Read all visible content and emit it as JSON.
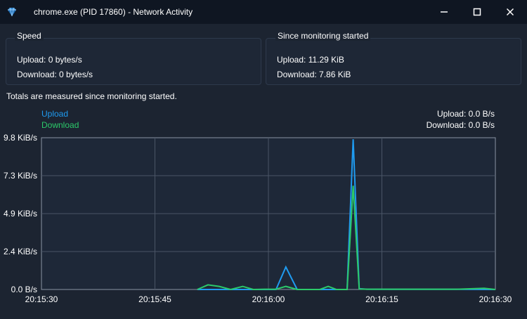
{
  "window": {
    "title": "chrome.exe (PID 17860) - Network Activity",
    "icon": "diamond-app-icon",
    "controls": [
      "minimize-icon",
      "maximize-icon",
      "close-icon"
    ]
  },
  "speed_panel": {
    "title": "Speed",
    "upload": "Upload: 0 bytes/s",
    "download": "Download: 0 bytes/s"
  },
  "totals_panel": {
    "title": "Since monitoring started",
    "upload": "Upload: 11.29 KiB",
    "download": "Download: 7.86 KiB"
  },
  "note": "Totals are measured since monitoring started.",
  "legend": {
    "upload": "Upload",
    "download": "Download"
  },
  "current": {
    "upload": "Upload: 0.0 B/s",
    "download": "Download: 0.0 B/s"
  },
  "colors": {
    "upload": "#1f9bf0",
    "download": "#2cc96a",
    "background": "#1c2431",
    "titlebar": "#0f1622"
  },
  "chart_data": {
    "type": "line",
    "x_ticks": [
      "20:15:30",
      "20:15:45",
      "20:16:00",
      "20:16:15",
      "20:16:30"
    ],
    "y_ticks": [
      "0.0 B/s",
      "2.4 KiB/s",
      "4.9 KiB/s",
      "7.3 KiB/s",
      "9.8 KiB/s"
    ],
    "y_tick_values": [
      0,
      2.45,
      4.9,
      7.35,
      9.8
    ],
    "xlim_seconds": [
      0,
      60
    ],
    "ylim": [
      0,
      9.8
    ],
    "grid": true,
    "series": [
      {
        "name": "Upload",
        "x": [
          20.6,
          22,
          23.5,
          25,
          26.6,
          28,
          29.5,
          31,
          32.3,
          33.8,
          35.2,
          36.8,
          37.9,
          39,
          40.4,
          41.2,
          42,
          43,
          46,
          50,
          55,
          60
        ],
        "y": [
          0,
          0,
          0,
          0,
          0,
          0,
          0,
          0,
          1.45,
          0,
          0,
          0,
          0,
          0,
          0,
          9.7,
          0.05,
          0.02,
          0.01,
          0.01,
          0.01,
          0
        ]
      },
      {
        "name": "Download",
        "x": [
          20.6,
          22,
          23.5,
          25,
          26.6,
          28,
          29.5,
          31,
          32.3,
          33.8,
          35.2,
          36.8,
          37.9,
          39,
          40.4,
          41.2,
          42,
          43,
          46,
          50,
          55,
          58.5,
          60
        ],
        "y": [
          0,
          0.3,
          0.2,
          0,
          0.2,
          0,
          0.02,
          0.02,
          0.2,
          0,
          0,
          0,
          0.2,
          0,
          0,
          6.7,
          0.03,
          0.02,
          0.02,
          0.02,
          0.02,
          0.08,
          0
        ]
      }
    ]
  }
}
